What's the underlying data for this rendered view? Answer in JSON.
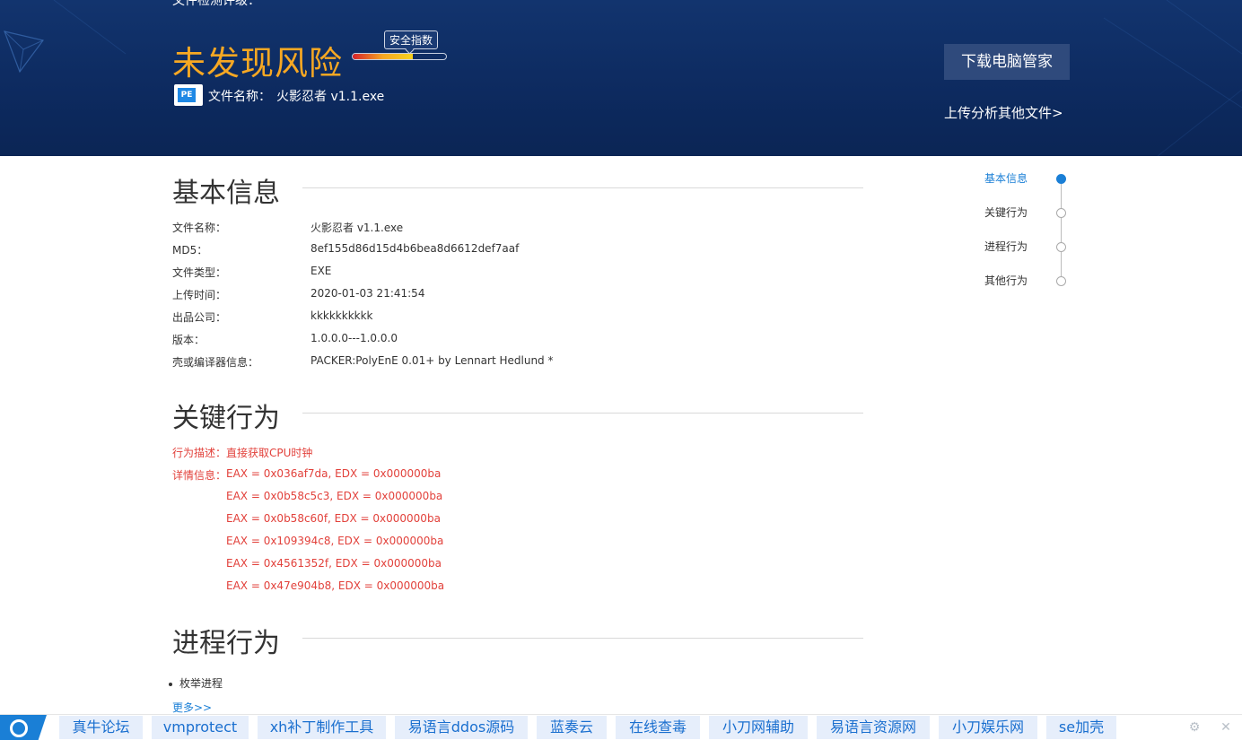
{
  "header": {
    "cut_title": "文件检测评级：",
    "verdict": "未发现风险",
    "score_label": "安全指数",
    "score_fraction": 0.64,
    "file_label": "文件名称：",
    "file_name": "火影忍者 v1.1.exe",
    "pe_icon_text": "PE",
    "download_button": "下载电脑管家",
    "upload_link": "上传分析其他文件>"
  },
  "basic_info": {
    "title": "基本信息",
    "rows": [
      {
        "key": "文件名称：",
        "value": "火影忍者 v1.1.exe"
      },
      {
        "key": "MD5：",
        "value": "8ef155d86d15d4b6bea8d6612def7aaf"
      },
      {
        "key": "文件类型：",
        "value": "EXE"
      },
      {
        "key": "上传时间：",
        "value": "2020-01-03 21:41:54"
      },
      {
        "key": "出品公司：",
        "value": "kkkkkkkkkk"
      },
      {
        "key": "版本：",
        "value": "1.0.0.0---1.0.0.0"
      },
      {
        "key": "壳或编译器信息：",
        "value": "PACKER:PolyEnE 0.01+ by Lennart Hedlund *"
      }
    ]
  },
  "key_behavior": {
    "title": "关键行为",
    "desc_label": "行为描述：",
    "desc_value": "直接获取CPU时钟",
    "detail_label": "详情信息：",
    "details": [
      "EAX = 0x036af7da, EDX = 0x000000ba",
      "EAX = 0x0b58c5c3, EDX = 0x000000ba",
      "EAX = 0x0b58c60f, EDX = 0x000000ba",
      "EAX = 0x109394c8, EDX = 0x000000ba",
      "EAX = 0x4561352f, EDX = 0x000000ba",
      "EAX = 0x47e904b8, EDX = 0x000000ba"
    ]
  },
  "process_behavior": {
    "title": "进程行为",
    "items": [
      "枚举进程"
    ],
    "more_link": "更多>>"
  },
  "side_nav": {
    "items": [
      {
        "label": "基本信息",
        "active": true
      },
      {
        "label": "关键行为",
        "active": false
      },
      {
        "label": "进程行为",
        "active": false
      },
      {
        "label": "其他行为",
        "active": false
      }
    ]
  },
  "bottom_bar": {
    "links": [
      "真牛论坛",
      "vmprotect",
      "xh补丁制作工具",
      "易语言ddos源码",
      "蓝奏云",
      "在线查毒",
      "小刀网辅助",
      "易语言资源网",
      "小刀娱乐网",
      "se加壳"
    ],
    "icons": [
      "settings-icon",
      "close-icon"
    ]
  },
  "colors": {
    "header_bg": "#0d2a5f",
    "verdict": "#f7a823",
    "accent": "#1a7fd6",
    "danger_text": "#e2413b"
  }
}
